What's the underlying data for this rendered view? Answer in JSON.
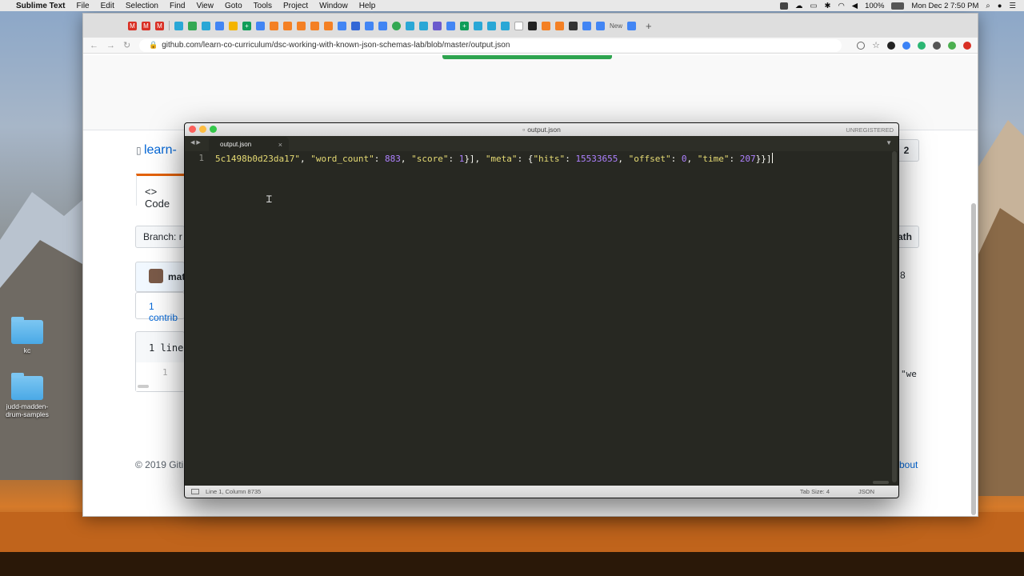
{
  "menubar": {
    "app_name": "Sublime Text",
    "items": [
      "File",
      "Edit",
      "Selection",
      "Find",
      "View",
      "Goto",
      "Tools",
      "Project",
      "Window",
      "Help"
    ],
    "battery": "100%",
    "datetime": "Mon Dec 2  7:50 PM"
  },
  "desktop": {
    "items": [
      {
        "label": "kc"
      },
      {
        "label": "judd-madden-drum-samples"
      }
    ]
  },
  "browser": {
    "url": "github.com/learn-co-curriculum/dsc-working-with-known-json-schemas-lab/blob/master/output.json",
    "tab_badge": "New"
  },
  "github": {
    "repo_title": "learn-",
    "code_tab": "Code",
    "branch": "Branch: r",
    "author": "mat",
    "contributors": "1 contrib",
    "lines": "1 line",
    "line_no": "1",
    "right_count": "2",
    "right_path": "ath",
    "right_num": "8",
    "right_we": "\"we",
    "footer_left": "© 2019 Giti",
    "footer_right": "bout"
  },
  "sublime": {
    "window_title": "output.json",
    "unregistered": "UNREGISTERED",
    "tab_label": "output.json",
    "line_number": "1",
    "code_line": {
      "str1": "5c1498b0d23da17\"",
      "key_wc": "\"word_count\"",
      "val_wc": "883",
      "key_score": "\"score\"",
      "val_score": "1",
      "key_meta": "\"meta\"",
      "key_hits": "\"hits\"",
      "val_hits": "15533655",
      "key_offset": "\"offset\"",
      "val_offset": "0",
      "key_time": "\"time\"",
      "val_time": "207"
    },
    "status_position": "Line 1, Column 8735",
    "status_tabsize": "Tab Size: 4",
    "status_syntax": "JSON"
  },
  "colors": {
    "editor_bg": "#272822",
    "string": "#e6db74",
    "number": "#ae81ff",
    "github_green": "#2ea44f"
  }
}
